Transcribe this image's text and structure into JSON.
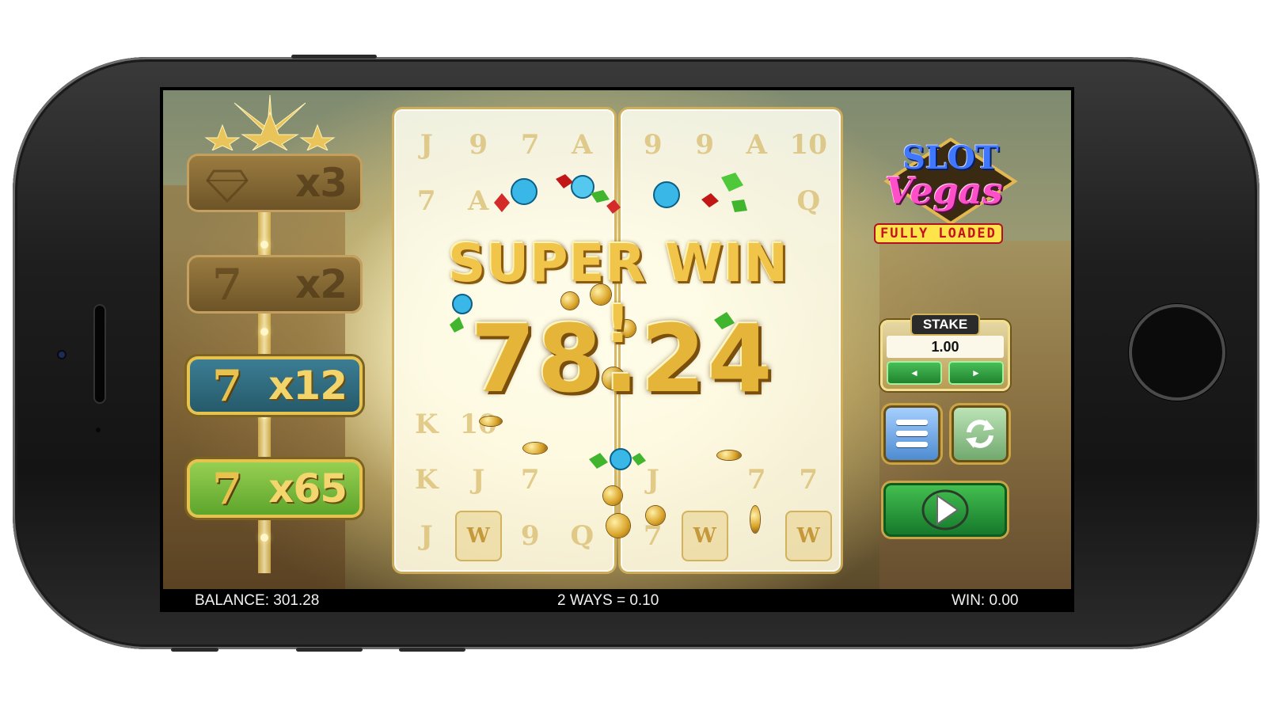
{
  "game": {
    "logo": {
      "line1": "SLOT",
      "line2": "Vegas",
      "line3": "FULLY LOADED"
    },
    "win_banner": "SUPER WIN !",
    "win_amount": "78.24",
    "multipliers": [
      {
        "symbol": "diamond-icon",
        "label": "x3",
        "state": "dim"
      },
      {
        "symbol": "seven",
        "glyph": "7",
        "label": "x2",
        "state": "dim"
      },
      {
        "symbol": "seven",
        "glyph": "7",
        "label": "x12",
        "state": "active-blue"
      },
      {
        "symbol": "seven",
        "glyph": "7",
        "label": "x65",
        "state": "active-green"
      }
    ],
    "reels_left": [
      [
        "J",
        "9",
        "7",
        "A"
      ],
      [
        "7",
        "A",
        "",
        ""
      ],
      [
        "",
        "",
        "",
        ""
      ],
      [
        "",
        "",
        "",
        ""
      ],
      [
        "",
        "",
        "",
        ""
      ],
      [
        "K",
        "10",
        "",
        ""
      ],
      [
        "K",
        "J",
        "7",
        ""
      ],
      [
        "J",
        "W",
        "9",
        "Q"
      ]
    ],
    "reels_right": [
      [
        "9",
        "9",
        "A",
        "10"
      ],
      [
        "",
        "",
        "",
        "Q"
      ],
      [
        "",
        "",
        "",
        ""
      ],
      [
        "",
        "",
        "",
        ""
      ],
      [
        "",
        "",
        "",
        ""
      ],
      [
        "",
        "",
        "",
        ""
      ],
      [
        "J",
        "",
        "7",
        "7"
      ],
      [
        "7",
        "W",
        "",
        "W"
      ]
    ]
  },
  "controls": {
    "stake_label": "STAKE",
    "stake_value": "1.00",
    "decrease_glyph": "◄",
    "increase_glyph": "►"
  },
  "status_bar": {
    "balance": "BALANCE: 301.28",
    "ways": "2 WAYS = 0.10",
    "win": "WIN: 0.00"
  },
  "colors": {
    "gold": "#e5b53a",
    "stake_arrow_green": "#1d7e2a",
    "menu_blue": "#4a88cf",
    "spin_green": "#14752a",
    "status_bg": "#000000"
  }
}
